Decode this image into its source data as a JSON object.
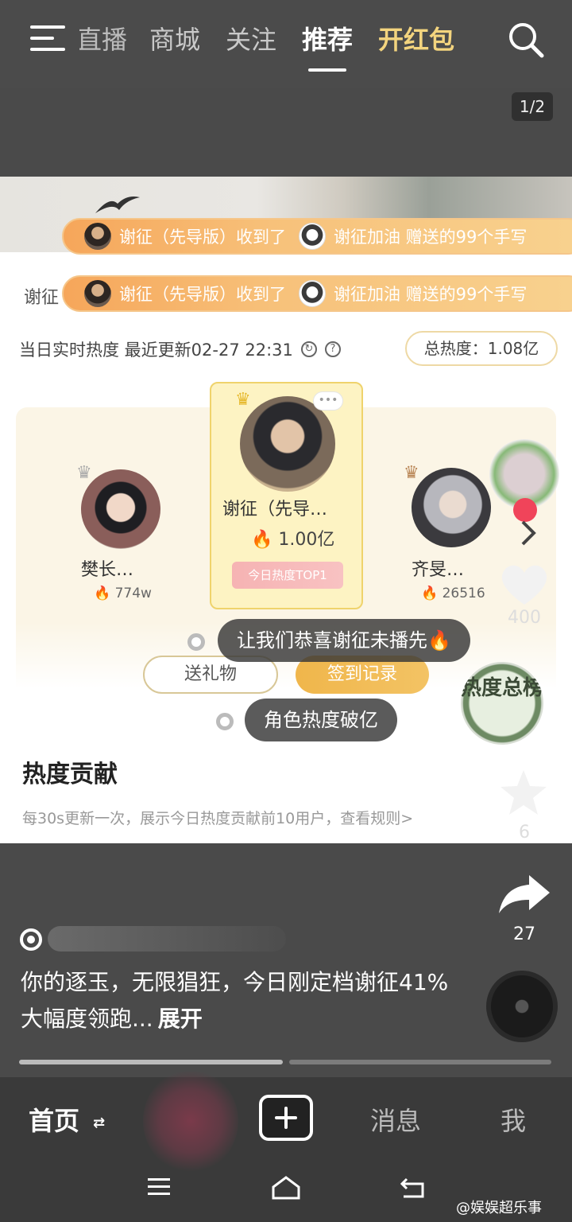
{
  "header": {
    "tabs": [
      {
        "label": "直播"
      },
      {
        "label": "商城"
      },
      {
        "label": "关注"
      },
      {
        "label": "推荐",
        "active": true
      },
      {
        "label": "开红包"
      }
    ],
    "page_counter": "1/2"
  },
  "card": {
    "tickers": [
      {
        "prefix": "",
        "text_1": "谢征（先导版）收到了",
        "text_2": "谢征加油 赠送的99个手写"
      },
      {
        "prefix": "谢征",
        "text_1": "谢征（先导版）收到了",
        "text_2": "谢征加油 赠送的99个手写"
      }
    ],
    "heat_label": "当日实时热度 最近更新02-27 22:31",
    "refresh_glyph": "↻",
    "help_glyph": "?",
    "total_heat": "总热度：1.08亿",
    "ranking": {
      "first": {
        "name": "谢征（先导…",
        "heat": "1.00亿",
        "tag": "今日热度TOP1",
        "more": "•••"
      },
      "second": {
        "name": "樊长…",
        "heat": "774w"
      },
      "third": {
        "name": "齐旻…",
        "heat": "26516"
      }
    },
    "bullets": [
      "让我们恭喜谢征未播先🔥",
      "角色热度破亿"
    ],
    "buttons": {
      "gift": "送礼物",
      "sign": "签到记录"
    },
    "contrib_title": "热度贡献",
    "contrib_sub": "每30s更新一次，展示今日热度贡献前10用户，查看规则>"
  },
  "side_actions": {
    "likes": "400",
    "favorites": "6",
    "shares": "27",
    "hot_badge": "热度总榜"
  },
  "caption": {
    "text": "你的逐玉，无限猖狂，今日刚定档谢征41%大幅度领跑...",
    "expand": "展开"
  },
  "bottom_nav": {
    "home": "首页",
    "home_switch_glyph": "⇄",
    "messages": "消息",
    "me": "我"
  },
  "watermark": "@娱娱超乐事",
  "colors": {
    "accent_gold": "#f3d47e",
    "ticker_orange": "#f6a65a",
    "sign_button": "#f0b64b"
  }
}
